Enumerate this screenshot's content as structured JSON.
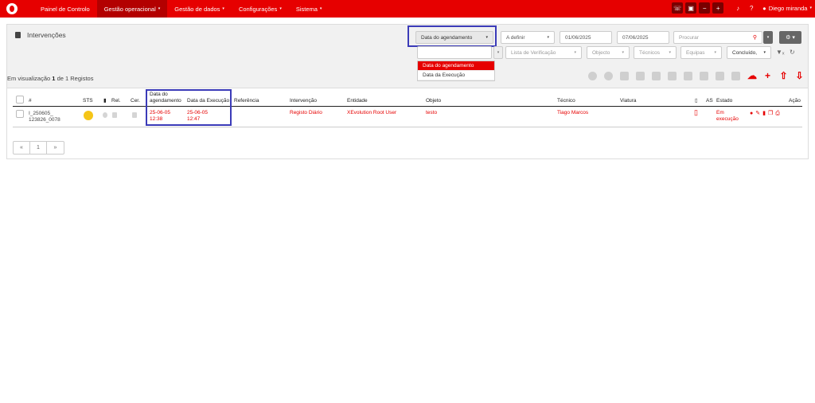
{
  "nav": {
    "items": [
      {
        "label": "Painel de Controlo",
        "caret": ""
      },
      {
        "label": "Gestão operacional",
        "caret": "▾"
      },
      {
        "label": "Gestão de dados",
        "caret": "▾"
      },
      {
        "label": "Configurações",
        "caret": "▾"
      },
      {
        "label": "Sistema",
        "caret": "▾"
      }
    ],
    "user": "Diego miranda",
    "user_caret": "▾"
  },
  "panel": {
    "title": "Intervenções",
    "date_type_select": "Data do agendamento",
    "status_select": "A definir",
    "date_from": "01/06/2025",
    "date_to": "07/06/2025",
    "search_placeholder": "Procurar",
    "filters": {
      "checklist": "Lista de Verificação",
      "object": "Objecto",
      "technicians": "Técnicos",
      "teams": "Equipas",
      "concluded": "Concluído,"
    },
    "dropdown_options": [
      "Data do agendamento",
      "Data da Execução"
    ]
  },
  "records": {
    "prefix": "Em visualização",
    "shown": "1",
    "middle": "de",
    "total": "1",
    "suffix": "Registos"
  },
  "table": {
    "headers": {
      "id": "#",
      "sts": "STS",
      "rel": "Rel.",
      "cer": "Cer.",
      "sched_line1": "Data do",
      "sched_line2": "agendamento",
      "exec": "Data da Execução",
      "ref": "Referência",
      "intervention": "Intervenção",
      "entity": "Entidade",
      "object": "Objeto",
      "technician": "Técnico",
      "vehicle": "Viatura",
      "as": "AS",
      "state": "Estado",
      "action": "Ação"
    },
    "rows": [
      {
        "id_line1": "I_250605_",
        "id_line2": "123826_0078",
        "sched_date": "25-06-05",
        "sched_time": "12:38",
        "exec_date": "25-06-05",
        "exec_time": "12:47",
        "ref": "",
        "intervention": "Registo Diário",
        "entity": "XEvolution Root User",
        "object": "testo",
        "technician": "Tiago Marcos",
        "vehicle": "",
        "state_line1": "Em",
        "state_line2": "execução"
      }
    ]
  },
  "pager": {
    "prev": "«",
    "page": "1",
    "next": "»"
  },
  "colors": {
    "accent": "#e60000",
    "highlight": "#3b3bb8",
    "status_dot": "#f5c518"
  }
}
